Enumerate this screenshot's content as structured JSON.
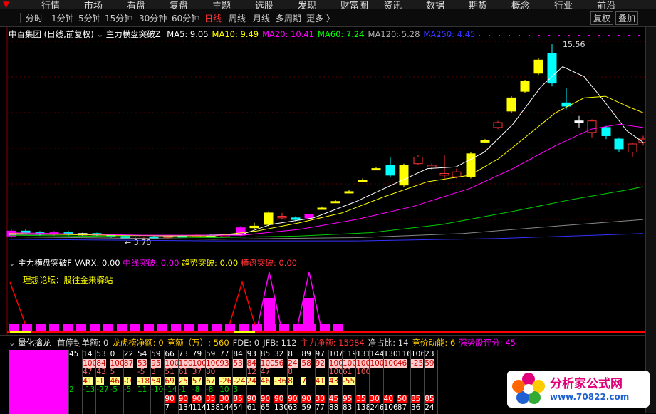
{
  "topnav": {
    "items": [
      "行情",
      "市场",
      "看盘",
      "复盘",
      "主题",
      "选股",
      "发现",
      "财富圈",
      "资讯",
      "数据",
      "期货",
      "概念",
      "行业",
      "前沿"
    ]
  },
  "toolbar": {
    "periods": [
      "分时",
      "1分钟",
      "5分钟",
      "15分钟",
      "30分钟",
      "60分钟",
      "日线",
      "周线",
      "月线",
      "多周期",
      "更多 〉"
    ],
    "active": "日线",
    "right_buttons": [
      "复权",
      "叠加"
    ]
  },
  "main": {
    "stock": "中百集团 (日线,前复权)",
    "indicator": "主力横盘突破Z",
    "ma": [
      {
        "label": "MA5: 9.05",
        "color": "#ffffff"
      },
      {
        "label": "MA10: 9.49",
        "color": "#ffff00"
      },
      {
        "label": "MA20: 10.41",
        "color": "#ff00ff"
      },
      {
        "label": "MA60: 7.24",
        "color": "#00ff00"
      },
      {
        "label": "MA120: 5.28",
        "color": "#aaaaaa"
      },
      {
        "label": "MA250: 4.45",
        "color": "#3333ff"
      }
    ],
    "high_label": "15.56",
    "low_label": "3.70"
  },
  "indicator1": {
    "name": "主力横盘突破F",
    "varx": "VARX: 0.00",
    "zx": "中线突破: 0.00",
    "qs": "趋势突破: 0.00",
    "hp": "横盘突破: 0.00",
    "forum": "理想论坛：股往金来驿站"
  },
  "indicator2": {
    "name": "量化擒龙",
    "fields": [
      {
        "label": "首停封单额: 0",
        "color": "#dddddd"
      },
      {
        "label": "龙虎榜净额: 0",
        "color": "#ffcc00"
      },
      {
        "label": "竞额（万）: 560",
        "color": "#ffcc00"
      },
      {
        "label": "FDE: 0",
        "color": "#dddddd"
      },
      {
        "label": "JFB: 112",
        "color": "#dddddd"
      },
      {
        "label": "主力净额: 15984",
        "color": "#ff3333"
      },
      {
        "label": "净占比: 14",
        "color": "#dddddd"
      },
      {
        "label": "竞价动能: 6",
        "color": "#ffcc00"
      },
      {
        "label": "强势股评分: 45",
        "color": "#ff00ff"
      }
    ],
    "rows": [
      [
        "45",
        "14",
        "53",
        "0",
        "22",
        "54",
        "59",
        "66",
        "73",
        "79",
        "59",
        "77",
        "84",
        "93",
        "85",
        "32",
        "8",
        "89",
        "97",
        "107",
        "119",
        "131",
        "144",
        "130",
        "116",
        "106",
        "23"
      ],
      [
        "",
        "100",
        "84",
        "100",
        "87",
        "53",
        "95",
        "100",
        "100",
        "100",
        "100",
        "93",
        "53",
        "84",
        "100",
        "56",
        "24",
        "58",
        "92",
        "100",
        "100",
        "100",
        "100",
        "100",
        "46",
        "-25",
        "59"
      ],
      [
        "",
        "47",
        "43",
        "5",
        "",
        "-5",
        "3",
        "51",
        "61",
        "37",
        "80",
        "",
        "",
        "12",
        "47",
        "",
        "8",
        "",
        "",
        "100",
        "61",
        "100",
        "",
        "",
        "",
        "",
        ""
      ],
      [
        "",
        "41",
        "-1",
        "46",
        "-0",
        "-18",
        "54",
        "69",
        "25",
        "57",
        "67",
        "-26",
        "-24",
        "24",
        "46",
        "-36",
        "8",
        "7",
        "41",
        "43",
        "-55",
        "",
        "",
        "",
        "",
        "",
        ""
      ],
      [
        "2",
        "-13",
        "-27",
        "-5",
        "-5",
        "11",
        "-10",
        "-14",
        "-1",
        "-8",
        "-8",
        "10",
        "3",
        "",
        "",
        "",
        "",
        "",
        "",
        "",
        "",
        "",
        "",
        "",
        "",
        "",
        ""
      ],
      [
        "",
        "",
        "",
        "",
        "",
        "",
        "",
        "90",
        "90",
        "90",
        "35",
        "30",
        "85",
        "90",
        "90",
        "90",
        "90",
        "90",
        "30",
        "45",
        "95",
        "35",
        "30",
        "40",
        "50",
        "85",
        "85"
      ],
      [
        "",
        "",
        "",
        "",
        "",
        "",
        "",
        "7",
        "134",
        "114",
        "138",
        "144",
        "54",
        "61",
        "65",
        "130",
        "63",
        "59",
        "77",
        "88",
        "83",
        "138",
        "246",
        "106",
        "87",
        "36",
        "24"
      ]
    ]
  }
}
